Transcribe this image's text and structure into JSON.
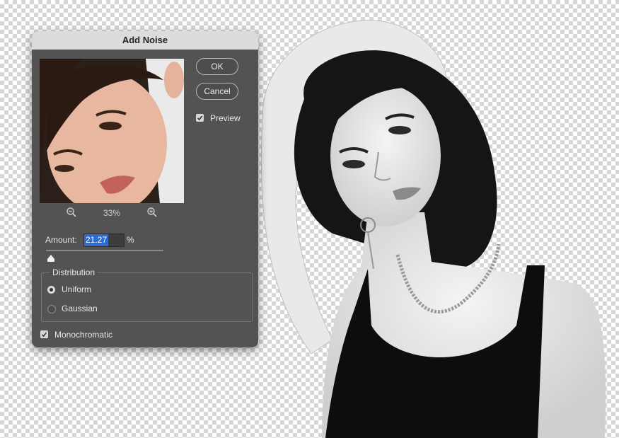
{
  "dialog": {
    "title": "Add Noise",
    "ok_label": "OK",
    "cancel_label": "Cancel",
    "preview_label": "Preview",
    "preview_checked": true,
    "zoom_level": "33%",
    "amount_label": "Amount:",
    "amount_value": "21.27",
    "amount_unit": "%",
    "amount_slider_fraction": 0.04,
    "distribution_legend": "Distribution",
    "distribution_options": [
      "Uniform",
      "Gaussian"
    ],
    "distribution_selected": "Uniform",
    "monochromatic_label": "Monochromatic",
    "monochromatic_checked": true
  },
  "icons": [
    "zoom-out-icon",
    "zoom-in-icon",
    "checkmark-icon",
    "slider-thumb-icon"
  ],
  "colors": {
    "dialog_bg": "#535353",
    "titlebar_bg": "#dcdcdc",
    "selection": "#2d6bd0",
    "checker_light": "#ffffff",
    "checker_dark": "#d6d6d6"
  }
}
